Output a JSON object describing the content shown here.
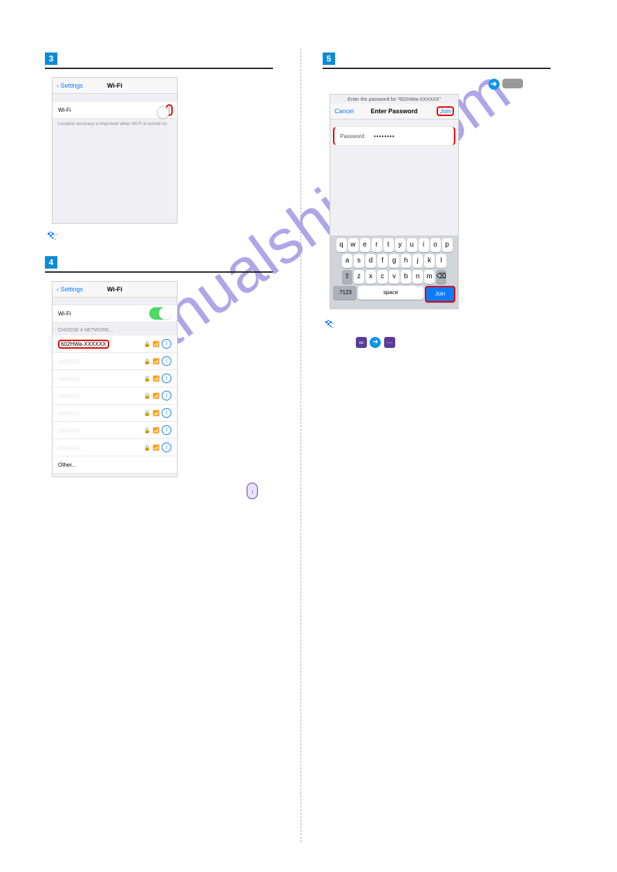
{
  "watermark": "manualshive.com",
  "steps": {
    "s3": "3",
    "s4": "4",
    "s5": "5"
  },
  "phone3": {
    "back": "Settings",
    "title": "Wi-Fi",
    "row_label": "Wi-Fi",
    "help": "Location accuracy is improved when Wi-Fi is turned on."
  },
  "phone4": {
    "back": "Settings",
    "title": "Wi-Fi",
    "row_label": "Wi-Fi",
    "section": "CHOOSE A NETWORK...",
    "networks": [
      "602HWa-XXXXXX",
      "————",
      "————",
      "————",
      "————",
      "————",
      "————"
    ],
    "other": "Other..."
  },
  "phone5": {
    "subhead": "Enter the password for \"602HWa-XXXXXX\"",
    "cancel": "Cancel",
    "title": "Enter Password",
    "join": "Join",
    "pwd_label": "Password",
    "pwd_value": "••••••••",
    "keys_r1": [
      "q",
      "w",
      "e",
      "r",
      "t",
      "y",
      "u",
      "i",
      "o",
      "p"
    ],
    "keys_r2": [
      "a",
      "s",
      "d",
      "f",
      "g",
      "h",
      "j",
      "k",
      "l"
    ],
    "keys_r3": [
      "z",
      "x",
      "c",
      "v",
      "b",
      "n",
      "m"
    ],
    "shift": "⇧",
    "bksp": "⌫",
    "numkey": ".?123",
    "space": "space",
    "join2": "Join",
    "info_icon_label": "i"
  }
}
